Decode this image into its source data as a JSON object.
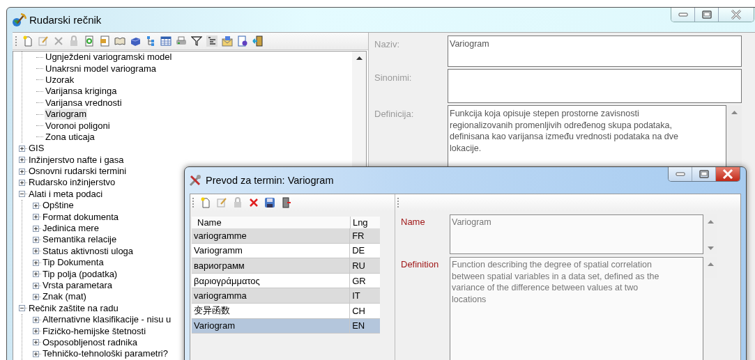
{
  "main_window": {
    "title": "Rudarski rečnik",
    "tree": {
      "partial_branch": [
        {
          "label": "Ugnježdeni variogramski model",
          "selected": false
        },
        {
          "label": "Unakrsni model variograma",
          "selected": false
        },
        {
          "label": "Uzorak",
          "selected": false
        },
        {
          "label": "Varijansa kriginga",
          "selected": false
        },
        {
          "label": "Varijansa vrednosti",
          "selected": false
        },
        {
          "label": "Variogram",
          "selected": true
        },
        {
          "label": "Voronoi poligoni",
          "selected": false
        },
        {
          "label": "Zona uticaja",
          "selected": false
        }
      ],
      "items": [
        {
          "label": "GIS",
          "expanded": false
        },
        {
          "label": "Inžinjerstvo nafte i gasa",
          "expanded": false
        },
        {
          "label": "Osnovni rudarski termini",
          "expanded": false
        },
        {
          "label": "Rudarsko inžinjerstvo",
          "expanded": false
        },
        {
          "label": "Alati i meta podaci",
          "expanded": true,
          "children": [
            {
              "label": "Opštine",
              "expanded": false
            },
            {
              "label": "Format dokumenta",
              "expanded": false
            },
            {
              "label": "Jedinica mere",
              "expanded": false
            },
            {
              "label": "Semantika relacije",
              "expanded": false
            },
            {
              "label": "Status aktivnosti uloga",
              "expanded": false
            },
            {
              "label": "Tip Dokumenta",
              "expanded": false
            },
            {
              "label": "Tip polja (podatka)",
              "expanded": false
            },
            {
              "label": "Vrsta parametara",
              "expanded": false
            },
            {
              "label": "Znak (mat)",
              "expanded": false
            }
          ]
        },
        {
          "label": "Rečnik zaštite na radu",
          "expanded": true,
          "children": [
            {
              "label": "Alternativne klasifikacije - nisu u",
              "expanded": false
            },
            {
              "label": "Fizičko-hemijske štetnosti",
              "expanded": false
            },
            {
              "label": "Osposobljenost radnika",
              "expanded": false
            },
            {
              "label": "Tehničko-tehnološki parametri?",
              "expanded": false
            }
          ]
        }
      ]
    },
    "form": {
      "fields": [
        {
          "label": "Naziv:",
          "value": "Variogram"
        },
        {
          "label": "Sinonimi:"
        },
        {
          "label": "Definicija:",
          "value": "Funkcija koja opisuje stepen prostorne zavisnosti regionalizovanih promenljivih određenog skupa podataka, definisana kao varijansa između vrednosti podataka na dve lokacije."
        }
      ]
    }
  },
  "dialog": {
    "title": "Prevod za termin: Variogram",
    "table": {
      "columns": [
        "Name",
        "Lng"
      ],
      "rows": [
        {
          "name": "variogramme",
          "lng": "FR",
          "selected": false
        },
        {
          "name": "Variogramm",
          "lng": "DE",
          "selected": false
        },
        {
          "name": "вариограмм",
          "lng": "RU",
          "selected": false
        },
        {
          "name": "βαριογράμματος",
          "lng": "GR",
          "selected": false
        },
        {
          "name": "variogramma",
          "lng": "IT",
          "selected": false
        },
        {
          "name": "变异函数",
          "lng": "CH",
          "selected": false
        },
        {
          "name": "Variogram",
          "lng": "EN",
          "selected": true
        }
      ]
    },
    "fields": [
      {
        "label": "Name",
        "value": "Variogram"
      },
      {
        "label": "Definition",
        "value": "Function describing the degree of spatial correlation between spatial variables in a data set, defined as the variance of the difference between values at two locations"
      }
    ]
  }
}
